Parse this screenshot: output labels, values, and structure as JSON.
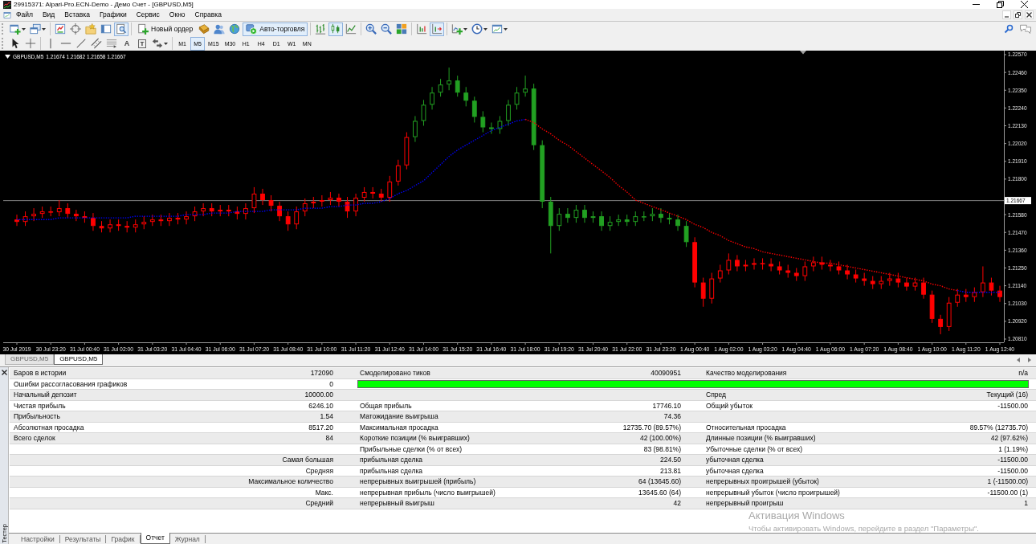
{
  "window": {
    "title": "29915371: Alpari-Pro.ECN-Demo - Демо Счет - [GBPUSD,M5]"
  },
  "menu": [
    "Файл",
    "Вид",
    "Вставка",
    "Графики",
    "Сервис",
    "Окно",
    "Справка"
  ],
  "toolbar_main": [
    [
      {
        "kind": "icon",
        "pressed": false
      },
      {
        "kind": "icon",
        "pressed": false
      }
    ],
    [
      {
        "kind": "icon",
        "pressed": false
      },
      {
        "kind": "icon",
        "pressed": false
      },
      {
        "kind": "icon",
        "pressed": false
      },
      {
        "kind": "icon",
        "pressed": false
      },
      {
        "kind": "icon",
        "pressed": true
      }
    ],
    [
      {
        "kind": "button",
        "label": "Новый ордер",
        "pressed": false
      },
      {
        "kind": "icon",
        "pressed": false
      },
      {
        "kind": "icon",
        "pressed": false
      },
      {
        "kind": "icon",
        "pressed": false
      },
      {
        "kind": "button",
        "label": "Авто-торговля",
        "pressed": true
      }
    ],
    [
      {
        "kind": "icon",
        "pressed": false
      },
      {
        "kind": "icon",
        "pressed": true
      },
      {
        "kind": "icon",
        "pressed": false
      }
    ],
    [
      {
        "kind": "icon",
        "pressed": false
      },
      {
        "kind": "icon",
        "pressed": false
      },
      {
        "kind": "icon",
        "pressed": false
      }
    ],
    [
      {
        "kind": "icon",
        "pressed": false
      },
      {
        "kind": "icon",
        "pressed": true
      }
    ],
    [
      {
        "kind": "icon",
        "pressed": false
      },
      {
        "kind": "icon",
        "pressed": false
      },
      {
        "kind": "icon",
        "pressed": false
      }
    ]
  ],
  "toolbar_drawing": [
    [
      {
        "kind": "icon",
        "pressed": false
      },
      {
        "kind": "icon",
        "pressed": false
      }
    ],
    [
      {
        "kind": "icon",
        "pressed": false
      },
      {
        "kind": "icon",
        "pressed": false
      },
      {
        "kind": "icon",
        "pressed": false
      },
      {
        "kind": "icon",
        "pressed": false
      },
      {
        "kind": "icon",
        "pressed": false
      },
      {
        "kind": "glyph",
        "label": "A",
        "pressed": false
      },
      {
        "kind": "boxed_glyph",
        "label": "T",
        "pressed": false
      },
      {
        "kind": "icon",
        "pressed": false
      }
    ]
  ],
  "timeframes": [
    {
      "label": "M1",
      "selected": false
    },
    {
      "label": "M5",
      "selected": true
    },
    {
      "label": "M15",
      "selected": false
    },
    {
      "label": "M30",
      "selected": false
    },
    {
      "label": "H1",
      "selected": false
    },
    {
      "label": "H4",
      "selected": false
    },
    {
      "label": "D1",
      "selected": false
    },
    {
      "label": "W1",
      "selected": false
    },
    {
      "label": "MN",
      "selected": false
    }
  ],
  "chart": {
    "chart_data": [
      {
        "type": "candlestick",
        "title": "GBPUSD,M5",
        "subtitle": "1.21674 1.21682 1.21658 1.21667",
        "categories": [
          "30 Jul 2019",
          null,
          null,
          null,
          "30 Jul 23:20",
          null,
          null,
          null,
          "31 Jul 00:40",
          null,
          null,
          null,
          "31 Jul 02:00",
          null,
          null,
          null,
          "31 Jul 03:20",
          null,
          null,
          null,
          "31 Jul 04:40",
          null,
          null,
          null,
          "31 Jul 06:00",
          null,
          null,
          null,
          "31 Jul 07:20",
          null,
          null,
          null,
          "31 Jul 08:40",
          null,
          null,
          null,
          "31 Jul 10:00",
          null,
          null,
          null,
          "31 Jul 11:20",
          null,
          null,
          null,
          "31 Jul 12:40",
          null,
          null,
          null,
          "31 Jul 14:00",
          null,
          null,
          null,
          "31 Jul 15:20",
          null,
          null,
          null,
          "31 Jul 16:40",
          null,
          null,
          null,
          "31 Jul 18:00",
          null,
          null,
          null,
          "31 Jul 19:20",
          null,
          null,
          null,
          "31 Jul 20:40",
          null,
          null,
          null,
          "31 Jul 22:00",
          null,
          null,
          null,
          "31 Jul 23:20",
          null,
          null,
          null,
          "1 Aug 00:40",
          null,
          null,
          null,
          "1 Aug 02:00",
          null,
          null,
          null,
          "1 Aug 03:20",
          null,
          null,
          null,
          "1 Aug 04:40",
          null,
          null,
          null,
          "1 Aug 06:00",
          null,
          null,
          null,
          "1 Aug 07:20",
          null,
          null,
          null,
          "1 Aug 08:40",
          null,
          null,
          null,
          "1 Aug 10:00",
          null,
          null,
          null,
          "1 Aug 11:20",
          null,
          null,
          null,
          "1 Aug 12:40"
        ],
        "ylim": [
          1.2079,
          1.2259
        ],
        "yticks": [
          {
            "value": 1.2257,
            "label": "1.22570"
          },
          {
            "value": 1.2246,
            "label": "1.22460"
          },
          {
            "value": 1.2235,
            "label": "1.22350"
          },
          {
            "value": 1.2224,
            "label": "1.22240"
          },
          {
            "value": 1.2213,
            "label": "1.22130"
          },
          {
            "value": 1.2202,
            "label": "1.22020"
          },
          {
            "value": 1.2191,
            "label": "1.21910"
          },
          {
            "value": 1.218,
            "label": "1.21800"
          },
          {
            "value": 1.2158,
            "label": "1.21580"
          },
          {
            "value": 1.2147,
            "label": "1.21470"
          },
          {
            "value": 1.2136,
            "label": "1.21360"
          },
          {
            "value": 1.2125,
            "label": "1.21250"
          },
          {
            "value": 1.2114,
            "label": "1.21140"
          },
          {
            "value": 1.2103,
            "label": "1.21030"
          },
          {
            "value": 1.2092,
            "label": "1.20920"
          },
          {
            "value": 1.2081,
            "label": "1.20810"
          }
        ],
        "ref_lines": [
          {
            "axis": "y",
            "value": 1.21667,
            "label": "1.21667",
            "color": "#808080"
          }
        ],
        "series": [
          {
            "type": "candlestick",
            "color": "#ff0000",
            "ohlc": [
              [
                1.2155,
                1.2158,
                1.2151,
                1.21535
              ],
              [
                1.21535,
                1.216,
                1.2151,
                1.2157
              ],
              [
                1.2157,
                1.2162,
                1.2154,
                1.21585
              ],
              [
                1.21585,
                1.2163,
                1.2156,
                1.216
              ],
              [
                1.216,
                1.2163,
                1.2157,
                1.21595
              ],
              [
                1.21595,
                1.2167,
                1.2157,
                1.2162
              ],
              [
                1.2162,
                1.2165,
                1.2156,
                1.21585
              ],
              [
                1.21585,
                1.2161,
                1.2154,
                1.2157
              ],
              [
                1.2157,
                1.216,
                1.2153,
                1.2156
              ],
              [
                1.2156,
                1.2159,
                1.2148,
                1.2151
              ],
              [
                1.2151,
                1.2154,
                1.2147,
                1.21495
              ],
              [
                1.21495,
                1.2155,
                1.2147,
                1.2152
              ],
              [
                1.2152,
                1.2155,
                1.2148,
                1.2151
              ],
              [
                1.2151,
                1.2154,
                1.2147,
                1.215
              ],
              [
                1.215,
                1.2155,
                1.2147,
                1.2152
              ],
              [
                1.2152,
                1.2157,
                1.2149,
                1.21535
              ],
              [
                1.21535,
                1.2158,
                1.2151,
                1.2155
              ],
              [
                1.2155,
                1.2158,
                1.2151,
                1.2154
              ],
              [
                1.2154,
                1.2159,
                1.2151,
                1.2156
              ],
              [
                1.2156,
                1.2159,
                1.2152,
                1.2155
              ],
              [
                1.2155,
                1.216,
                1.2152,
                1.2157
              ],
              [
                1.2157,
                1.2163,
                1.2154,
                1.216
              ],
              [
                1.216,
                1.2165,
                1.2157,
                1.2162
              ],
              [
                1.2162,
                1.2165,
                1.2157,
                1.216
              ],
              [
                1.216,
                1.2164,
                1.2157,
                1.2161
              ],
              [
                1.2161,
                1.2164,
                1.2157,
                1.216
              ],
              [
                1.216,
                1.2163,
                1.2155,
                1.21585
              ],
              [
                1.21585,
                1.2165,
                1.2155,
                1.2162
              ],
              [
                1.2162,
                1.2175,
                1.2159,
                1.2171
              ],
              [
                1.2171,
                1.2174,
                1.2164,
                1.2167
              ],
              [
                1.2167,
                1.217,
                1.216,
                1.21635
              ],
              [
                1.21635,
                1.2166,
                1.2154,
                1.2157
              ],
              [
                1.2157,
                1.216,
                1.2148,
                1.2152
              ],
              [
                1.2152,
                1.2163,
                1.2149,
                1.216
              ],
              [
                1.216,
                1.2168,
                1.2157,
                1.2165
              ],
              [
                1.2165,
                1.2169,
                1.2162,
                1.2166
              ],
              [
                1.2166,
                1.217,
                1.2163,
                1.2167
              ],
              [
                1.2167,
                1.2172,
                1.2164,
                1.21685
              ],
              [
                1.21685,
                1.2171,
                1.2163,
                1.2166
              ],
              [
                1.2166,
                1.2169,
                1.2156,
                1.216
              ],
              [
                1.216,
                1.2171,
                1.2157,
                1.21685
              ],
              [
                1.21685,
                1.2175,
                1.2166,
                1.2172
              ],
              [
                1.2172,
                1.2175,
                1.2168,
                1.2171
              ],
              [
                1.2171,
                1.2174,
                1.2166,
                1.21685
              ],
              [
                1.21685,
                1.2182,
                1.2166,
                1.21785
              ],
              [
                1.21785,
                1.2192,
                1.2176,
                1.21885
              ],
              [
                1.21885,
                1.2209,
                1.2186,
                1.2206
              ],
              null,
              null,
              null,
              null,
              null,
              null,
              null,
              null,
              null,
              null,
              null,
              null,
              null,
              null,
              null,
              null,
              null,
              null,
              null,
              null,
              null,
              null,
              null,
              null,
              null,
              null,
              null,
              null,
              null,
              null,
              null,
              null,
              null,
              [
                1.2141,
                1.2144,
                1.2113,
                1.2116
              ],
              [
                1.2116,
                1.2119,
                1.2101,
                1.2106
              ],
              [
                1.2106,
                1.2122,
                1.2103,
                1.21185
              ],
              [
                1.21185,
                1.2127,
                1.2116,
                1.21235
              ],
              [
                1.21235,
                1.2134,
                1.2121,
                1.213
              ],
              [
                1.213,
                1.2133,
                1.2123,
                1.2126
              ],
              [
                1.2126,
                1.213,
                1.2123,
                1.2127
              ],
              [
                1.2127,
                1.2131,
                1.2124,
                1.2128
              ],
              [
                1.2128,
                1.2131,
                1.2124,
                1.21275
              ],
              [
                1.21275,
                1.2131,
                1.2123,
                1.2126
              ],
              [
                1.2126,
                1.2129,
                1.2121,
                1.21235
              ],
              [
                1.21235,
                1.2127,
                1.2119,
                1.2122
              ],
              [
                1.2122,
                1.2125,
                1.2117,
                1.212
              ],
              [
                1.212,
                1.2129,
                1.2117,
                1.2126
              ],
              [
                1.2126,
                1.2132,
                1.2123,
                1.21285
              ],
              [
                1.21285,
                1.2132,
                1.2124,
                1.2127
              ],
              [
                1.2127,
                1.213,
                1.2123,
                1.2126
              ],
              [
                1.2126,
                1.2129,
                1.2121,
                1.21235
              ],
              [
                1.21235,
                1.2127,
                1.2118,
                1.2121
              ],
              [
                1.2121,
                1.2124,
                1.2116,
                1.21185
              ],
              [
                1.21185,
                1.2122,
                1.2114,
                1.2117
              ],
              [
                1.2117,
                1.212,
                1.2112,
                1.2115
              ],
              [
                1.2115,
                1.212,
                1.2112,
                1.2117
              ],
              [
                1.2117,
                1.2122,
                1.2114,
                1.21185
              ],
              [
                1.21185,
                1.2122,
                1.2113,
                1.2116
              ],
              [
                1.2116,
                1.2119,
                1.2111,
                1.21135
              ],
              [
                1.21135,
                1.2119,
                1.2111,
                1.2116
              ],
              [
                1.2116,
                1.2119,
                1.2106,
                1.21085
              ],
              [
                1.21085,
                1.2111,
                1.2091,
                1.20935
              ],
              [
                1.20935,
                1.2096,
                1.2084,
                1.20885
              ],
              [
                1.20885,
                1.2107,
                1.2086,
                1.21035
              ],
              [
                1.21035,
                1.2112,
                1.2101,
                1.21085
              ],
              [
                1.21085,
                1.2112,
                1.2104,
                1.2107
              ],
              [
                1.2107,
                1.2113,
                1.2104,
                1.211
              ],
              [
                1.211,
                1.2126,
                1.2107,
                1.2116
              ],
              [
                1.2116,
                1.2119,
                1.2108,
                1.2111
              ],
              [
                1.2111,
                1.2114,
                1.2104,
                1.2107
              ]
            ]
          },
          {
            "type": "candlestick",
            "color": "#22a022",
            "ohlc": [
              null,
              null,
              null,
              null,
              null,
              null,
              null,
              null,
              null,
              null,
              null,
              null,
              null,
              null,
              null,
              null,
              null,
              null,
              null,
              null,
              null,
              null,
              null,
              null,
              null,
              null,
              null,
              null,
              null,
              null,
              null,
              null,
              null,
              null,
              null,
              null,
              null,
              null,
              null,
              null,
              null,
              null,
              null,
              null,
              null,
              null,
              null,
              [
                1.2206,
                1.2219,
                1.2203,
                1.2216
              ],
              [
                1.2216,
                1.2229,
                1.2213,
                1.2226
              ],
              [
                1.2226,
                1.2237,
                1.2223,
                1.22335
              ],
              [
                1.22335,
                1.2242,
                1.2231,
                1.22385
              ],
              [
                1.22385,
                1.2249,
                1.2235,
                1.2241
              ],
              [
                1.2241,
                1.2244,
                1.2231,
                1.22335
              ],
              [
                1.22335,
                1.2237,
                1.2225,
                1.22285
              ],
              [
                1.22285,
                1.2231,
                1.2215,
                1.22185
              ],
              [
                1.22185,
                1.2222,
                1.2209,
                1.2212
              ],
              [
                1.2212,
                1.2215,
                1.2208,
                1.2211
              ],
              [
                1.2211,
                1.2219,
                1.2208,
                1.2216
              ],
              [
                1.2216,
                1.2229,
                1.2213,
                1.2226
              ],
              [
                1.2226,
                1.2237,
                1.2223,
                1.22335
              ],
              [
                1.22335,
                1.2244,
                1.2231,
                1.2236
              ],
              [
                1.2236,
                1.2239,
                1.2198,
                1.2201
              ],
              [
                1.2201,
                1.2204,
                1.2162,
                1.2166
              ],
              [
                1.2166,
                1.2169,
                1.2134,
                1.2151
              ],
              [
                1.2151,
                1.2162,
                1.2148,
                1.21585
              ],
              [
                1.21585,
                1.2162,
                1.2153,
                1.2156
              ],
              [
                1.2156,
                1.2164,
                1.2153,
                1.2161
              ],
              [
                1.2161,
                1.2164,
                1.2153,
                1.2156
              ],
              [
                1.2156,
                1.216,
                1.2153,
                1.2157
              ],
              [
                1.2157,
                1.216,
                1.2148,
                1.2151
              ],
              [
                1.2151,
                1.2157,
                1.2148,
                1.21535
              ],
              [
                1.21535,
                1.2158,
                1.2151,
                1.2155
              ],
              [
                1.2155,
                1.2158,
                1.2151,
                1.21535
              ],
              [
                1.21535,
                1.216,
                1.2151,
                1.2157
              ],
              [
                1.2157,
                1.216,
                1.2154,
                1.2157
              ],
              [
                1.2157,
                1.2162,
                1.2154,
                1.21585
              ],
              [
                1.21585,
                1.2162,
                1.2153,
                1.2156
              ],
              [
                1.2156,
                1.2159,
                1.2152,
                1.2155
              ],
              [
                1.2155,
                1.2158,
                1.2148,
                1.2151
              ],
              [
                1.2151,
                1.2154,
                1.2138,
                1.2141
              ],
              null,
              null,
              null,
              null,
              null,
              null,
              null,
              null,
              null,
              null,
              null,
              null,
              null,
              null,
              null,
              null,
              null,
              null,
              null,
              null,
              null,
              null,
              null,
              null,
              null,
              null,
              null,
              null,
              null,
              null,
              null,
              null,
              null,
              null,
              null,
              null,
              null
            ]
          },
          {
            "type": "line",
            "color": "#0000ff",
            "line_style": "dotted",
            "values": [
              1.2155,
              1.2155,
              1.2155,
              1.2155,
              1.2155,
              1.2156,
              1.2156,
              1.2156,
              1.2156,
              1.2156,
              1.2156,
              1.2156,
              1.2156,
              1.2156,
              1.2157,
              1.2157,
              1.2157,
              1.2157,
              1.2157,
              1.2157,
              1.2158,
              1.2158,
              1.2158,
              1.2159,
              1.2159,
              1.2159,
              1.216,
              1.216,
              1.216,
              1.216,
              1.2161,
              1.2161,
              1.2161,
              1.2161,
              1.2162,
              1.2162,
              1.2162,
              1.2163,
              1.2163,
              1.2164,
              1.2164,
              1.2165,
              1.2165,
              1.2166,
              1.2168,
              1.2171,
              1.2173,
              1.2176,
              1.2179,
              1.2184,
              1.2189,
              1.2194,
              1.2198,
              1.2201,
              1.2204,
              1.2207,
              1.221,
              1.2212,
              1.2214,
              1.2216,
              1.2217,
              null,
              null,
              null,
              null,
              null,
              null,
              null,
              null,
              null,
              null,
              null,
              null,
              null,
              null,
              null,
              null,
              null,
              null,
              null,
              null,
              null,
              null,
              null,
              null,
              null,
              null,
              null,
              null,
              null,
              null,
              null,
              null,
              null,
              null,
              null,
              null,
              null,
              null,
              null,
              null,
              null,
              null,
              null,
              null,
              null,
              null,
              null,
              null,
              null,
              null,
              1.2111,
              1.211,
              1.211,
              1.211,
              1.211,
              1.211
            ]
          },
          {
            "type": "line",
            "color": "#ff0000",
            "line_style": "dotted",
            "values": [
              null,
              null,
              null,
              null,
              null,
              null,
              null,
              null,
              null,
              null,
              null,
              null,
              null,
              null,
              null,
              null,
              null,
              null,
              null,
              null,
              null,
              null,
              null,
              null,
              null,
              null,
              null,
              null,
              null,
              null,
              null,
              null,
              null,
              null,
              null,
              null,
              null,
              null,
              null,
              null,
              null,
              null,
              null,
              null,
              null,
              null,
              null,
              null,
              null,
              null,
              null,
              null,
              null,
              null,
              null,
              null,
              null,
              null,
              null,
              null,
              1.2217,
              1.2215,
              1.2211,
              1.2208,
              1.2204,
              1.2201,
              1.2197,
              1.2193,
              1.2189,
              1.2185,
              1.2181,
              1.2176,
              1.2172,
              1.2167,
              1.2165,
              1.2163,
              1.2161,
              1.2159,
              1.2157,
              1.2155,
              1.2152,
              1.215,
              1.2147,
              1.2145,
              1.2142,
              1.214,
              1.2138,
              1.2137,
              1.2135,
              1.2134,
              1.2133,
              1.2132,
              1.2131,
              1.213,
              1.2129,
              1.2128,
              1.2128,
              1.2127,
              1.2126,
              1.2125,
              1.2124,
              1.2123,
              1.2122,
              1.2121,
              1.212,
              1.2119,
              1.2118,
              1.2117,
              1.2115,
              1.2114,
              1.2112,
              1.2111,
              null,
              null,
              null,
              null,
              null
            ]
          }
        ]
      }
    ]
  },
  "chart_tabs": [
    {
      "label": "GBPUSD,M5",
      "selected": false
    },
    {
      "label": "GBPUSD,M5",
      "selected": true
    }
  ],
  "tester": {
    "title": "Тестер",
    "report": {
      "rows": [
        {
          "kind": "text",
          "cells": [
            "Баров в истории",
            "172090",
            "Смоделировано тиков",
            "40090951",
            "Качество моделирования",
            "n/a"
          ]
        },
        {
          "kind": "bar",
          "cells": [
            "Ошибки рассогласования графиков",
            "0"
          ],
          "level": 1
        },
        {
          "kind": "text",
          "cells": [
            "Начальный депозит",
            "10000.00",
            null,
            null,
            "Спред",
            "Текущий (16)"
          ]
        },
        {
          "kind": "text",
          "cells": [
            "Чистая прибыль",
            "6246.10",
            "Общая прибыль",
            "17746.10",
            "Общий убыток",
            "-11500.00"
          ]
        },
        {
          "kind": "text",
          "cells": [
            "Прибыльность",
            "1.54",
            "Матожидание выигрыша",
            "74.36",
            null,
            null
          ]
        },
        {
          "kind": "text",
          "cells": [
            "Абсолютная просадка",
            "8517.20",
            "Максимальная просадка",
            "12735.70 (89.57%)",
            "Относительная просадка",
            "89.57% (12735.70)"
          ]
        },
        {
          "kind": "text",
          "cells": [
            "Всего сделок",
            "84",
            "Короткие позиции (% выигравших)",
            "42 (100.00%)",
            "Длинные позиции (% выигравших)",
            "42 (97.62%)"
          ]
        },
        {
          "kind": "text",
          "cells": [
            null,
            null,
            "Прибыльные сделки (% от всех)",
            "83 (98.81%)",
            "Убыточные сделки (% от всех)",
            "1 (1.19%)"
          ]
        },
        {
          "kind": "text",
          "cells": [
            null,
            "Самая большая",
            "прибыльная сделка",
            "224.50",
            "убыточная сделка",
            "-11500.00"
          ]
        },
        {
          "kind": "text",
          "cells": [
            null,
            "Средняя",
            "прибыльная сделка",
            "213.81",
            "убыточная сделка",
            "-11500.00"
          ]
        },
        {
          "kind": "text",
          "cells": [
            null,
            "Максимальное количество",
            "непрерывных выигрышей (прибыль)",
            "64 (13645.60)",
            "непрерывных проигрышей (убыток)",
            "1 (-11500.00)"
          ]
        },
        {
          "kind": "text",
          "cells": [
            null,
            "Макс.",
            "непрерывная прибыль (число выигрышей)",
            "13645.60 (64)",
            "непрерывный убыток (число проигрышей)",
            "-11500.00 (1)"
          ]
        },
        {
          "kind": "text",
          "cells": [
            null,
            "Средний",
            "непрерывный выигрыш",
            "42",
            "непрерывный проигрыш",
            "1"
          ]
        }
      ]
    },
    "tabs": [
      {
        "label": "Настройки",
        "selected": false
      },
      {
        "label": "Результаты",
        "selected": false
      },
      {
        "label": "График",
        "selected": false
      },
      {
        "label": "Отчет",
        "selected": true
      },
      {
        "label": "Журнал",
        "selected": false
      }
    ]
  },
  "os_notice": {
    "title": "Активация Windows",
    "text": "Чтобы активировать Windows, перейдите в раздел \"Параметры\"."
  }
}
